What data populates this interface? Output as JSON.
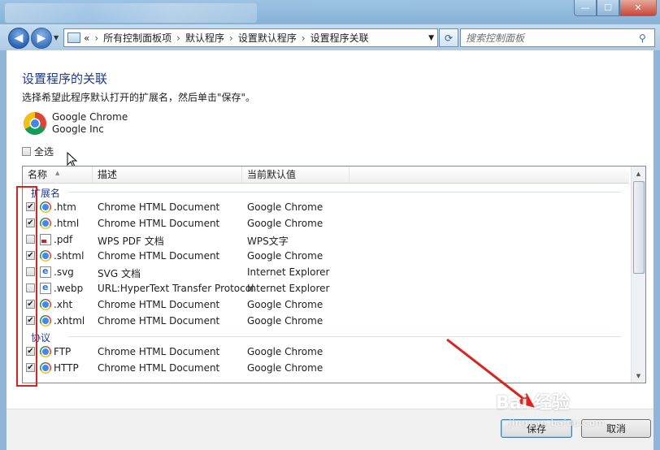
{
  "window": {
    "min_glyph": "—",
    "max_glyph": "☐",
    "close_glyph": "✕"
  },
  "nav": {
    "breadcrumb": [
      "所有控制面板项",
      "默认程序",
      "设置默认程序",
      "设置程序关联"
    ],
    "address_prefix": "«",
    "separator": "›",
    "search_placeholder": "搜索控制面板"
  },
  "page": {
    "title": "设置程序的关联",
    "instruction": "选择希望此程序默认打开的扩展名，然后单击\"保存\"。",
    "app_name": "Google Chrome",
    "app_company": "Google Inc",
    "select_all_label": "全选"
  },
  "list": {
    "columns": [
      "名称",
      "描述",
      "当前默认值"
    ],
    "groups": [
      {
        "label": "扩展名",
        "rows": [
          {
            "name": ".htm",
            "desc": "Chrome HTML Document",
            "default": "Google Chrome",
            "checked": true,
            "icon": "chrome"
          },
          {
            "name": ".html",
            "desc": "Chrome HTML Document",
            "default": "Google Chrome",
            "checked": true,
            "icon": "chrome"
          },
          {
            "name": ".pdf",
            "desc": "WPS PDF 文档",
            "default": "WPS文字",
            "checked": false,
            "icon": "pdf"
          },
          {
            "name": ".shtml",
            "desc": "Chrome HTML Document",
            "default": "Google Chrome",
            "checked": true,
            "icon": "chrome"
          },
          {
            "name": ".svg",
            "desc": "SVG 文档",
            "default": "Internet Explorer",
            "checked": false,
            "icon": "ie"
          },
          {
            "name": ".webp",
            "desc": "URL:HyperText Transfer Protocol",
            "default": "Internet Explorer",
            "checked": false,
            "icon": "ie"
          },
          {
            "name": ".xht",
            "desc": "Chrome HTML Document",
            "default": "Google Chrome",
            "checked": true,
            "icon": "chrome"
          },
          {
            "name": ".xhtml",
            "desc": "Chrome HTML Document",
            "default": "Google Chrome",
            "checked": true,
            "icon": "chrome"
          }
        ]
      },
      {
        "label": "协议",
        "rows": [
          {
            "name": "FTP",
            "desc": "Chrome HTML Document",
            "default": "Google Chrome",
            "checked": true,
            "icon": "chrome"
          },
          {
            "name": "HTTP",
            "desc": "Chrome HTML Document",
            "default": "Google Chrome",
            "checked": true,
            "icon": "chrome"
          }
        ]
      }
    ]
  },
  "buttons": {
    "save": "保存",
    "cancel": "取消"
  },
  "watermark": {
    "text": "Bai 经验",
    "sub": "jingyan.baidu.com"
  },
  "colors": {
    "annotation": "#e0201b",
    "title": "#1e3a8a"
  }
}
